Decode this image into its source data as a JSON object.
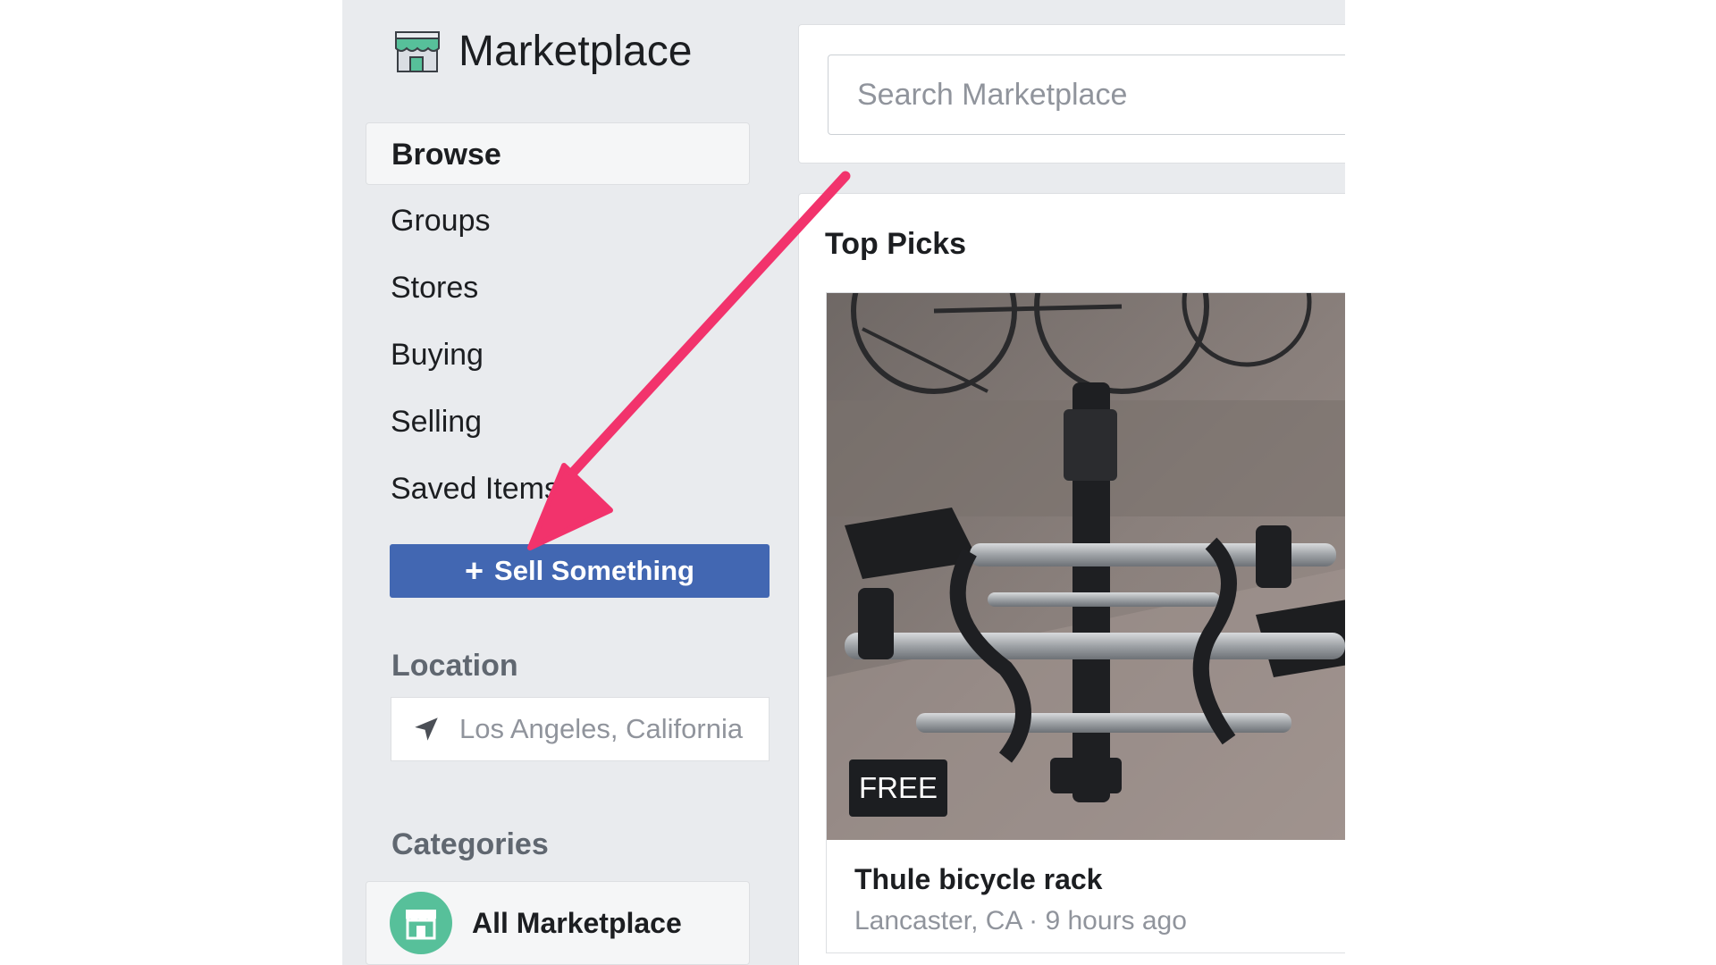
{
  "sidebar": {
    "title": "Marketplace",
    "brand_icon": "storefront-icon",
    "nav_items": [
      {
        "label": "Browse",
        "active": true
      },
      {
        "label": "Groups"
      },
      {
        "label": "Stores"
      },
      {
        "label": "Buying"
      },
      {
        "label": "Selling"
      },
      {
        "label": "Saved Items"
      }
    ],
    "sell_button": {
      "icon": "+",
      "label": "Sell Something",
      "color": "#4267b2"
    },
    "location": {
      "title": "Location",
      "value": "Los Angeles, California",
      "icon": "location-arrow-icon"
    },
    "categories": {
      "title": "Categories",
      "items": [
        {
          "label": "All Marketplace",
          "icon": "storefront-icon",
          "color": "#57c09a"
        }
      ]
    }
  },
  "search": {
    "placeholder": "Search Marketplace"
  },
  "main": {
    "section_title": "Top Picks",
    "listings": [
      {
        "price": "FREE",
        "title": "Thule bicycle rack",
        "location": "Lancaster, CA",
        "time": "9 hours ago",
        "meta": "Lancaster, CA · 9 hours ago"
      }
    ]
  },
  "annotation": {
    "type": "arrow",
    "color": "#f2336c",
    "points_to": "Sell Something"
  }
}
